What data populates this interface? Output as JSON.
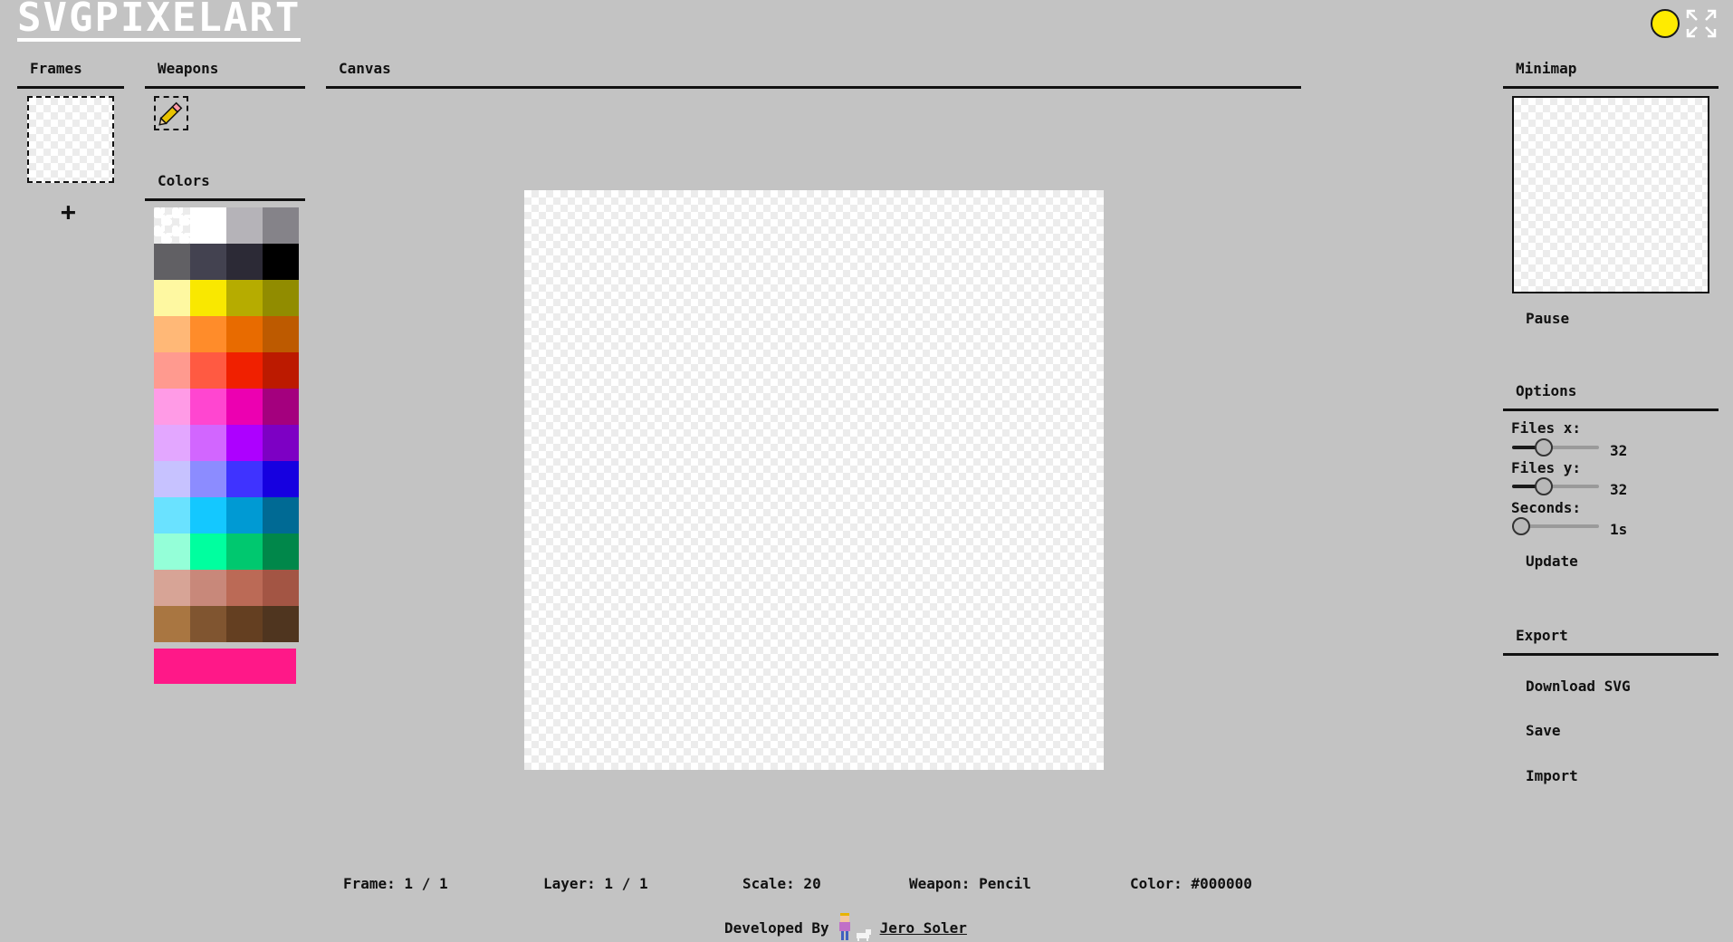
{
  "app": {
    "logo": "SVGPIXELART"
  },
  "panels": {
    "frames": "Frames",
    "weapons": "Weapons",
    "colors": "Colors",
    "canvas": "Canvas",
    "minimap": "Minimap",
    "options": "Options",
    "export": "Export"
  },
  "frames": {
    "add_label": "+"
  },
  "weapons": [
    {
      "name": "pencil-icon",
      "selected": true
    }
  ],
  "palette": [
    "#ffffff",
    "#ffffff",
    "#b5b3b8",
    "#858389",
    "#616064",
    "#434250",
    "#2c2a36",
    "#000000",
    "#fef8a1",
    "#f9e800",
    "#b6ac00",
    "#918c00",
    "#ffb877",
    "#ff8c2a",
    "#e86b00",
    "#bd5a00",
    "#ff9a8f",
    "#ff5a42",
    "#f02000",
    "#bc1a00",
    "#ff9be6",
    "#ff46d0",
    "#ec00b1",
    "#a4007e",
    "#e3a7ff",
    "#d266ff",
    "#ad00ff",
    "#7d00c4",
    "#c7c2ff",
    "#8c8cff",
    "#3f33ff",
    "#1600e0",
    "#6ae2ff",
    "#14c8ff",
    "#009ad3",
    "#006a94",
    "#94ffd8",
    "#00ff9f",
    "#00c86f",
    "#00874a",
    "#d7a496",
    "#c8887a",
    "#bb6a56",
    "#a35544",
    "#a97641",
    "#805530",
    "#643f21",
    "#4f351f"
  ],
  "current_color": "#ff1888",
  "minimap": {
    "pause_label": "Pause"
  },
  "options": {
    "files_x_label": "Files x:",
    "files_x_value": "32",
    "files_x_level": 0.33,
    "files_y_label": "Files y:",
    "files_y_value": "32",
    "files_y_level": 0.33,
    "seconds_label": "Seconds:",
    "seconds_value": "1s",
    "seconds_level": 0.0,
    "update_label": "Update"
  },
  "export": {
    "download_label": "Download SVG",
    "save_label": "Save",
    "import_label": "Import"
  },
  "status": {
    "frame": "Frame: 1 / 1",
    "layer": "Layer: 1 / 1",
    "scale": "Scale: 20",
    "weapon": "Weapon: Pencil",
    "color": "Color: #000000"
  },
  "footer": {
    "developed_by": "Developed By",
    "author": "Jero Soler"
  },
  "colors": {
    "background": "#c3c3c3",
    "sun": "#ffeb00"
  }
}
